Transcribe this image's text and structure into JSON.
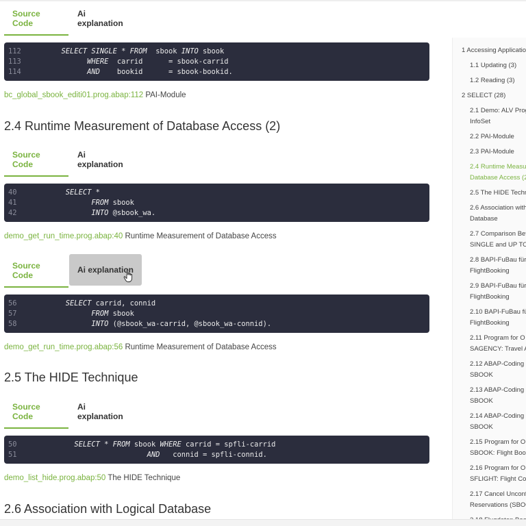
{
  "tabs": {
    "source": "Source Code",
    "ai": "Ai explanation"
  },
  "block0": {
    "lines": [
      {
        "n": "112",
        "parts": [
          [
            "      ",
            ""
          ],
          [
            "SELECT SINGLE",
            "kw"
          ],
          [
            " * ",
            ""
          ],
          [
            "FROM",
            "kw"
          ],
          [
            "  sbook ",
            ""
          ],
          [
            "INTO",
            "kw"
          ],
          [
            " sbook",
            ""
          ]
        ]
      },
      {
        "n": "113",
        "parts": [
          [
            "            ",
            ""
          ],
          [
            "WHERE",
            "kw"
          ],
          [
            "  carrid      = sbook-carrid",
            ""
          ]
        ]
      },
      {
        "n": "114",
        "parts": [
          [
            "            ",
            ""
          ],
          [
            "AND",
            "kw"
          ],
          [
            "    bookid      = sbook-bookid.",
            ""
          ]
        ]
      }
    ],
    "ref_link": "bc_global_sbook_editi01.prog.abap:112",
    "ref_text": " PAI-Module"
  },
  "heading_24": "2.4 Runtime Measurement of Database Access (2)",
  "block1": {
    "lines": [
      {
        "n": "40",
        "parts": [
          [
            "       ",
            ""
          ],
          [
            "SELECT",
            "kw"
          ],
          [
            " *",
            ""
          ]
        ]
      },
      {
        "n": "41",
        "parts": [
          [
            "             ",
            ""
          ],
          [
            "FROM",
            "kw"
          ],
          [
            " sbook",
            ""
          ]
        ]
      },
      {
        "n": "42",
        "parts": [
          [
            "             ",
            ""
          ],
          [
            "INTO",
            "kw"
          ],
          [
            " @sbook_wa.",
            ""
          ]
        ]
      }
    ],
    "ref_link": "demo_get_run_time.prog.abap:40",
    "ref_text": " Runtime Measurement of Database Access"
  },
  "block2": {
    "lines": [
      {
        "n": "56",
        "parts": [
          [
            "       ",
            ""
          ],
          [
            "SELECT",
            "kw"
          ],
          [
            " carrid, connid",
            ""
          ]
        ]
      },
      {
        "n": "57",
        "parts": [
          [
            "             ",
            ""
          ],
          [
            "FROM",
            "kw"
          ],
          [
            " sbook",
            ""
          ]
        ]
      },
      {
        "n": "58",
        "parts": [
          [
            "             ",
            ""
          ],
          [
            "INTO",
            "kw"
          ],
          [
            " (@sbook_wa-carrid, @sbook_wa-connid).",
            ""
          ]
        ]
      }
    ],
    "ref_link": "demo_get_run_time.prog.abap:56",
    "ref_text": " Runtime Measurement of Database Access"
  },
  "heading_25": "2.5 The HIDE Technique",
  "block3": {
    "lines": [
      {
        "n": "50",
        "parts": [
          [
            "         ",
            ""
          ],
          [
            "SELECT",
            "kw"
          ],
          [
            " * ",
            ""
          ],
          [
            "FROM",
            "kw"
          ],
          [
            " sbook ",
            ""
          ],
          [
            "WHERE",
            "kw"
          ],
          [
            " carrid = spfli-carrid",
            ""
          ]
        ]
      },
      {
        "n": "51",
        "parts": [
          [
            "                          ",
            ""
          ],
          [
            "AND",
            "kw"
          ],
          [
            "   connid = spfli-connid.",
            ""
          ]
        ]
      }
    ],
    "ref_link": "demo_list_hide.prog.abap:50",
    "ref_text": " The HIDE Technique"
  },
  "heading_26": "2.6 Association with Logical Database",
  "toc": [
    {
      "t": "1 Accessing Applicatio",
      "lvl": 1
    },
    {
      "t": "1.1 Updating (3)",
      "lvl": 2
    },
    {
      "t": "1.2 Reading (3)",
      "lvl": 2
    },
    {
      "t": "2 SELECT (28)",
      "lvl": 1
    },
    {
      "t": "2.1 Demo: ALV Prog",
      "lvl": 2
    },
    {
      "t": "InfoSet",
      "lvl": 2
    },
    {
      "t": "2.2 PAI-Module",
      "lvl": 2
    },
    {
      "t": "2.3 PAI-Module",
      "lvl": 2
    },
    {
      "t": "2.4 Runtime Measu",
      "lvl": 2,
      "active": true
    },
    {
      "t": "Database Access (2)",
      "lvl": 2,
      "active": true
    },
    {
      "t": "2.5 The HIDE Techn",
      "lvl": 2
    },
    {
      "t": "2.6 Association with",
      "lvl": 2
    },
    {
      "t": "Database",
      "lvl": 2
    },
    {
      "t": "2.7 Comparison Bet",
      "lvl": 2
    },
    {
      "t": "SINGLE and UP TO",
      "lvl": 2
    },
    {
      "t": "2.8 BAPI-FuBau für",
      "lvl": 2
    },
    {
      "t": "FlightBooking",
      "lvl": 2
    },
    {
      "t": "2.9 BAPI-FuBau für",
      "lvl": 2
    },
    {
      "t": "FlightBooking",
      "lvl": 2
    },
    {
      "t": "2.10 BAPI-FuBau fü",
      "lvl": 2
    },
    {
      "t": "FlightBooking",
      "lvl": 2
    },
    {
      "t": "2.11 Program for O",
      "lvl": 2
    },
    {
      "t": "SAGENCY: Travel Ag",
      "lvl": 2
    },
    {
      "t": "2.12 ABAP-Coding :",
      "lvl": 2
    },
    {
      "t": "SBOOK",
      "lvl": 2
    },
    {
      "t": "2.13 ABAP-Coding :",
      "lvl": 2
    },
    {
      "t": "SBOOK",
      "lvl": 2
    },
    {
      "t": "2.14 ABAP-Coding :",
      "lvl": 2
    },
    {
      "t": "SBOOK",
      "lvl": 2
    },
    {
      "t": "2.15 Program for O",
      "lvl": 2
    },
    {
      "t": "SBOOK: Flight Book",
      "lvl": 2
    },
    {
      "t": "2.16 Program for O",
      "lvl": 2
    },
    {
      "t": "SFLIGHT: Flight Cor",
      "lvl": 2
    },
    {
      "t": "2.17 Cancel Unconf",
      "lvl": 2
    },
    {
      "t": "Reservations (SBOO",
      "lvl": 2
    },
    {
      "t": "2.18 Flugdaten Bearb",
      "lvl": 2
    }
  ],
  "colors": {
    "accent": "#7ab33f",
    "code_bg": "#2b2d3d"
  },
  "icons": {
    "cursor": "hand-pointer-icon"
  }
}
